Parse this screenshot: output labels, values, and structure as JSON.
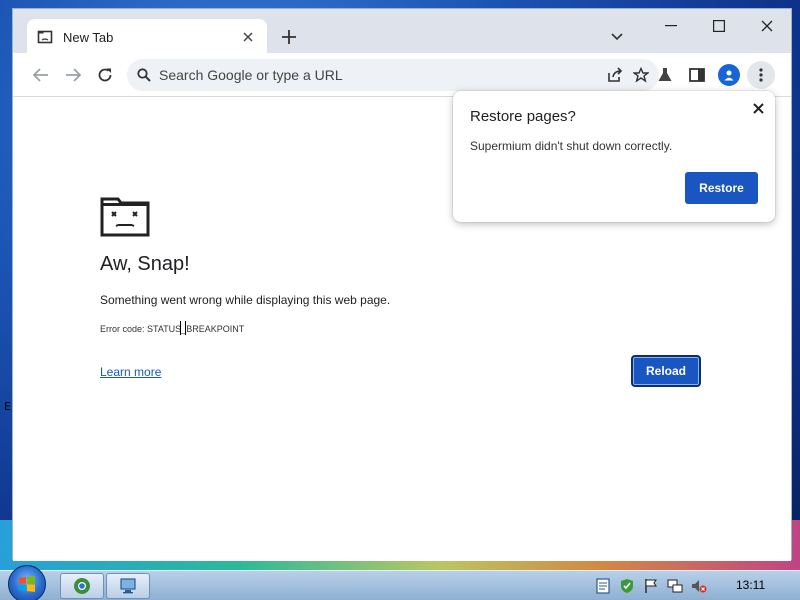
{
  "browser": {
    "tab": {
      "title": "New Tab",
      "favicon": "sad-page-icon",
      "close": "close-icon"
    },
    "new_tab": "plus-icon",
    "tab_search": "chevron-down-icon",
    "window_controls": [
      "minimize-icon",
      "maximize-icon",
      "close-icon"
    ],
    "omnibox": {
      "placeholder": "Search Google or type a URL",
      "value": ""
    },
    "toolbar_icons": [
      "share-icon",
      "bookmark-star-icon",
      "experiments-flask-icon",
      "side-panel-icon",
      "profile-icon",
      "menu-icon"
    ]
  },
  "crash_page": {
    "title": "Aw, Snap!",
    "message": "Something went wrong while displaying this web page.",
    "error_code": "Error code: STATUS_BREAKPOINT",
    "learn_more": "Learn more",
    "reload": "Reload"
  },
  "restore_popup": {
    "title": "Restore pages?",
    "message": "Supermium didn't shut down correctly.",
    "button": "Restore"
  },
  "taskbar": {
    "clock": "13:11",
    "pinned": [
      "browser-icon",
      "network-app-icon"
    ],
    "tray": [
      "notes-icon",
      "security-shield-icon",
      "action-center-flag-icon",
      "network-icon",
      "volume-muted-icon"
    ]
  },
  "colors": {
    "accent": "#1a56c2",
    "page_bg": "#ffffff",
    "chrome_frame": "#dee3eb"
  }
}
